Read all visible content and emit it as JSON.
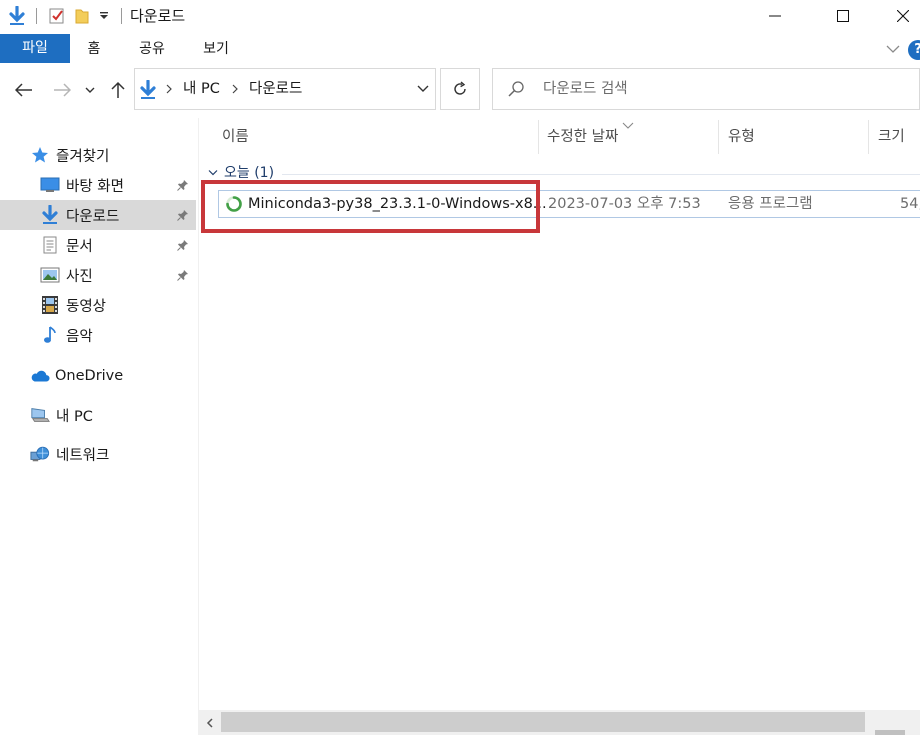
{
  "window": {
    "title": "다운로드",
    "quick_access_icons": [
      "download-arrow-icon",
      "properties-check-icon",
      "new-folder-icon",
      "customize-dropdown-icon"
    ]
  },
  "ribbon": {
    "tabs": [
      {
        "label": "파일",
        "active": true
      },
      {
        "label": "홈"
      },
      {
        "label": "공유"
      },
      {
        "label": "보기"
      }
    ],
    "help_label": "?"
  },
  "nav": {
    "breadcrumb": [
      "내 PC",
      "다운로드"
    ],
    "search_placeholder": "다운로드 검색"
  },
  "sidebar": {
    "quick_access": {
      "label": "즐겨찾기",
      "items": [
        {
          "label": "바탕 화면",
          "icon": "desktop-icon",
          "pinned": true
        },
        {
          "label": "다운로드",
          "icon": "download-icon",
          "pinned": true,
          "selected": true
        },
        {
          "label": "문서",
          "icon": "document-icon",
          "pinned": true
        },
        {
          "label": "사진",
          "icon": "pictures-icon",
          "pinned": true
        },
        {
          "label": "동영상",
          "icon": "video-icon"
        },
        {
          "label": "음악",
          "icon": "music-icon"
        }
      ]
    },
    "onedrive": {
      "label": "OneDrive"
    },
    "this_pc": {
      "label": "내 PC"
    },
    "network": {
      "label": "네트워크"
    }
  },
  "file_list": {
    "columns": [
      "이름",
      "수정한 날짜",
      "유형",
      "크기"
    ],
    "group": {
      "label": "오늘 (1)"
    },
    "rows": [
      {
        "name": "Miniconda3-py38_23.3.1-0-Windows-x8...",
        "modified": "2023-07-03 오후 7:53",
        "type": "응용 프로그램",
        "size": "54,"
      }
    ]
  },
  "colors": {
    "accent": "#1e6ec1",
    "highlight_box": "#c8373a",
    "selected_bg": "#d9d9d9"
  }
}
